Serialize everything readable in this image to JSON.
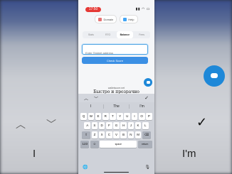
{
  "status": {
    "time": "17:50",
    "icons": "▮▮ ◠ ▭"
  },
  "nav": {
    "left_label": "Domain",
    "right_label": "Help"
  },
  "tabs": [
    "Stats",
    "RTO",
    "Balance",
    "Fees"
  ],
  "active_tab": 2,
  "input": {
    "placeholder": "Enter Testnet address",
    "value": ""
  },
  "check_button": "Check Score",
  "watermark": {
    "small": "walletscore.net",
    "big": "Быстро и прозрачно"
  },
  "suggestions": [
    "I",
    "The",
    "I'm"
  ],
  "keyboard": {
    "row1": [
      "Q",
      "W",
      "E",
      "R",
      "T",
      "Y",
      "U",
      "I",
      "O",
      "P"
    ],
    "row2": [
      "A",
      "S",
      "D",
      "F",
      "G",
      "H",
      "J",
      "K",
      "L"
    ],
    "row3": [
      "Z",
      "X",
      "C",
      "V",
      "B",
      "N",
      "M"
    ],
    "shift": "⇧",
    "delete": "⌫",
    "numbers": "123",
    "emoji": "☺",
    "space": "space",
    "return": "return",
    "globe": "🌐",
    "mic": "🎙"
  },
  "background_ghost": {
    "left_word": "I",
    "right_word": "I'm"
  }
}
